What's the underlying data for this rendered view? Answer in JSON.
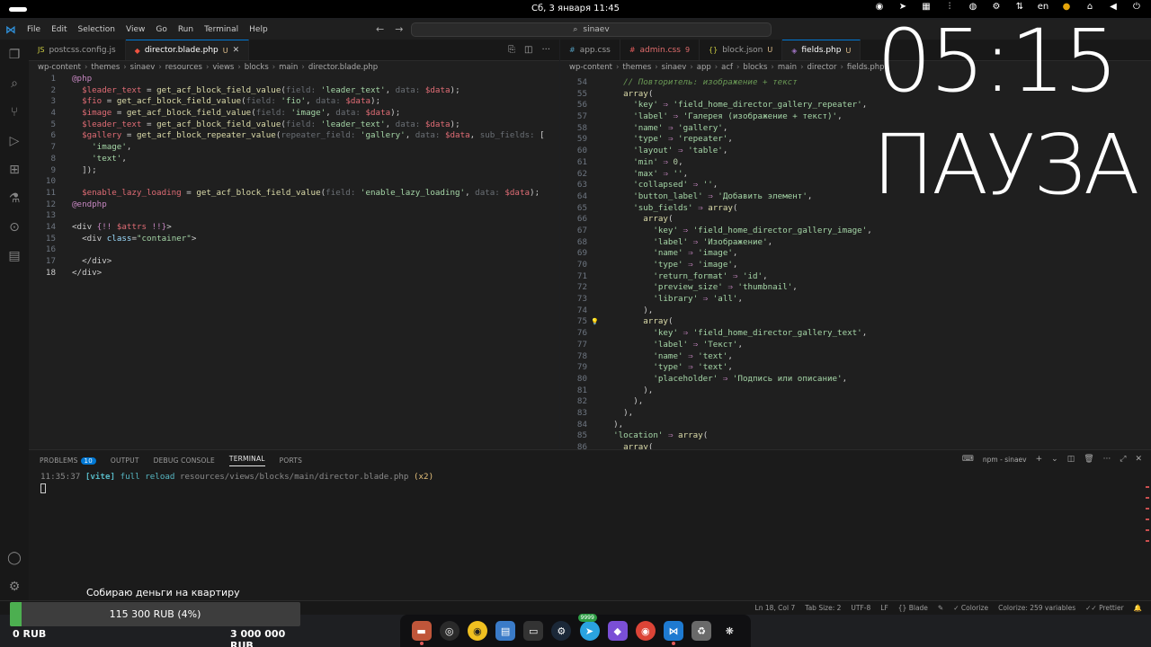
{
  "system": {
    "clock": "Сб, 3 января  11:45",
    "language": "en"
  },
  "menu": {
    "items": [
      "File",
      "Edit",
      "Selection",
      "View",
      "Go",
      "Run",
      "Terminal",
      "Help"
    ],
    "search": "sinaev"
  },
  "left_editor": {
    "tabs": [
      {
        "label": "postcss.config.js",
        "icon": "JS",
        "modified": "",
        "active": false
      },
      {
        "label": "director.blade.php",
        "icon": "blade-icon",
        "modified": "U",
        "active": true
      }
    ],
    "breadcrumb": [
      "wp-content",
      "themes",
      "sinaev",
      "resources",
      "views",
      "blocks",
      "main",
      "director.blade.php"
    ]
  },
  "right_editor": {
    "tabs": [
      {
        "label": "app.css",
        "icon": "#",
        "modified": "",
        "active": false
      },
      {
        "label": "admin.css",
        "icon": "#",
        "modified": "9",
        "active": false
      },
      {
        "label": "block.json",
        "icon": "{}",
        "modified": "U",
        "active": false
      },
      {
        "label": "fields.php",
        "icon": "php-icon",
        "modified": "U",
        "active": true
      }
    ],
    "breadcrumb": [
      "wp-content",
      "themes",
      "sinaev",
      "app",
      "acf",
      "blocks",
      "main",
      "director",
      "fields.php"
    ]
  },
  "panel": {
    "tabs": [
      "PROBLEMS",
      "OUTPUT",
      "DEBUG CONSOLE",
      "TERMINAL",
      "PORTS"
    ],
    "problems_count": "10",
    "terminal_name": "npm - sinaev",
    "terminal_line": {
      "time": "11:35:37",
      "tag": "[vite]",
      "message": "full reload",
      "path": "resources/views/blocks/main/director.blade.php",
      "count": "(x2)"
    }
  },
  "statusbar": {
    "position": "Ln 18, Col 7",
    "tab_size": "Tab Size: 2",
    "encoding": "UTF-8",
    "eol": "LF",
    "language": "Blade",
    "colorize": "Colorize",
    "colorize_vars": "Colorize: 259 variables",
    "prettier": "Prettier"
  },
  "overlay": {
    "timer": "05:15",
    "status": "ПАУЗА",
    "fundraiser": {
      "title": "Собираю деньги на квартиру",
      "current_label": "115 300 RUB (4%)",
      "progress_fraction": 0.04,
      "min_label": "0 RUB",
      "max_label": "3 000 000 RUB"
    }
  },
  "dock": {
    "items": [
      "files-icon",
      "obs-icon",
      "rhythmbox-icon",
      "text-editor-icon",
      "terminal-icon",
      "steam-icon",
      "telegram-icon",
      "obsidian-icon",
      "chrome-icon",
      "vscode-icon",
      "trash-icon",
      "settings-icon"
    ],
    "telegram_badge": "9999"
  },
  "code_left": [
    {
      "n": "1",
      "html": "<span class='t-kw'>@php</span>"
    },
    {
      "n": "2",
      "html": "  <span class='t-var'>$leader_text</span> = <span class='t-fn'>get_acf_block_field_value</span>(<span class='t-hint'>field: </span><span class='t-str'>'leader_text'</span>, <span class='t-hint'>data: </span><span class='t-var'>$data</span>);"
    },
    {
      "n": "3",
      "html": "  <span class='t-var'>$fio</span> = <span class='t-fn'>get_acf_block_field_value</span>(<span class='t-hint'>field: </span><span class='t-str'>'fio'</span>, <span class='t-hint'>data: </span><span class='t-var'>$data</span>);"
    },
    {
      "n": "4",
      "html": "  <span class='t-var'>$image</span> = <span class='t-fn'>get_acf_block_field_value</span>(<span class='t-hint'>field: </span><span class='t-str'>'image'</span>, <span class='t-hint'>data: </span><span class='t-var'>$data</span>);"
    },
    {
      "n": "5",
      "html": "  <span class='t-var'>$leader_text</span> = <span class='t-fn'>get_acf_block_field_value</span>(<span class='t-hint'>field: </span><span class='t-str'>'leader_text'</span>, <span class='t-hint'>data: </span><span class='t-var'>$data</span>);"
    },
    {
      "n": "6",
      "html": "  <span class='t-var'>$gallery</span> = <span class='t-fn'>get_acf_block_repeater_value</span>(<span class='t-hint'>repeater_field: </span><span class='t-str'>'gallery'</span>, <span class='t-hint'>data: </span><span class='t-var'>$data</span>, <span class='t-hint'>sub_fields: </span>["
    },
    {
      "n": "7",
      "html": "    <span class='t-str'>'image'</span>,"
    },
    {
      "n": "8",
      "html": "    <span class='t-str'>'text'</span>,"
    },
    {
      "n": "9",
      "html": "  ]);"
    },
    {
      "n": "10",
      "html": ""
    },
    {
      "n": "11",
      "html": "  <span class='t-var'>$enable_lazy_loading</span> = <span class='t-fn'>get_acf_block_field_value</span>(<span class='t-hint'>field: </span><span class='t-str'>'enable_lazy_loading'</span>, <span class='t-hint'>data: </span><span class='t-var'>$data</span>);"
    },
    {
      "n": "12",
      "html": "<span class='t-kw'>@endphp</span>"
    },
    {
      "n": "13",
      "html": ""
    },
    {
      "n": "14",
      "html": "<span class='t-tag'>&lt;div</span> <span class='t-kw'>{!!</span> <span class='t-var'>$attrs</span> <span class='t-kw'>!!}</span><span class='t-tag'>&gt;</span>"
    },
    {
      "n": "15",
      "html": "  <span class='t-tag'>&lt;div</span> <span class='t-attr'>class</span>=<span class='t-str'>\"container\"</span><span class='t-tag'>&gt;</span>"
    },
    {
      "n": "16",
      "html": ""
    },
    {
      "n": "17",
      "html": "  <span class='t-tag'>&lt;/div&gt;</span>"
    },
    {
      "n": "18",
      "html": "<span class='t-tag'>&lt;/div&gt;</span>",
      "current": true
    }
  ],
  "code_right": [
    {
      "n": "54",
      "html": "    <span class='t-com'>// Повторитель: изображение + текст</span>"
    },
    {
      "n": "55",
      "html": "    <span class='t-fn'>array</span>("
    },
    {
      "n": "56",
      "html": "      <span class='t-str'>'key'</span> <span class='t-kw'>⇒</span> <span class='t-str'>'field_home_director_gallery_repeater'</span>,"
    },
    {
      "n": "57",
      "html": "      <span class='t-str'>'label'</span> <span class='t-kw'>⇒</span> <span class='t-str'>'Галерея (изображение + текст)'</span>,"
    },
    {
      "n": "58",
      "html": "      <span class='t-str'>'name'</span> <span class='t-kw'>⇒</span> <span class='t-str'>'gallery'</span>,"
    },
    {
      "n": "59",
      "html": "      <span class='t-str'>'type'</span> <span class='t-kw'>⇒</span> <span class='t-str'>'repeater'</span>,"
    },
    {
      "n": "60",
      "html": "      <span class='t-str'>'layout'</span> <span class='t-kw'>⇒</span> <span class='t-str'>'table'</span>,"
    },
    {
      "n": "61",
      "html": "      <span class='t-str'>'min'</span> <span class='t-kw'>⇒</span> <span class='t-num'>0</span>,"
    },
    {
      "n": "62",
      "html": "      <span class='t-str'>'max'</span> <span class='t-kw'>⇒</span> <span class='t-str'>''</span>,"
    },
    {
      "n": "63",
      "html": "      <span class='t-str'>'collapsed'</span> <span class='t-kw'>⇒</span> <span class='t-str'>''</span>,"
    },
    {
      "n": "64",
      "html": "      <span class='t-str'>'button_label'</span> <span class='t-kw'>⇒</span> <span class='t-str'>'Добавить элемент'</span>,"
    },
    {
      "n": "65",
      "html": "      <span class='t-str'>'sub_fields'</span> <span class='t-kw'>⇒</span> <span class='t-fn'>array</span>("
    },
    {
      "n": "66",
      "html": "        <span class='t-fn'>array</span>("
    },
    {
      "n": "67",
      "html": "          <span class='t-str'>'key'</span> <span class='t-kw'>⇒</span> <span class='t-str'>'field_home_director_gallery_image'</span>,"
    },
    {
      "n": "68",
      "html": "          <span class='t-str'>'label'</span> <span class='t-kw'>⇒</span> <span class='t-str'>'Изображение'</span>,"
    },
    {
      "n": "69",
      "html": "          <span class='t-str'>'name'</span> <span class='t-kw'>⇒</span> <span class='t-str'>'image'</span>,"
    },
    {
      "n": "70",
      "html": "          <span class='t-str'>'type'</span> <span class='t-kw'>⇒</span> <span class='t-str'>'image'</span>,"
    },
    {
      "n": "71",
      "html": "          <span class='t-str'>'return_format'</span> <span class='t-kw'>⇒</span> <span class='t-str'>'id'</span>,"
    },
    {
      "n": "72",
      "html": "          <span class='t-str'>'preview_size'</span> <span class='t-kw'>⇒</span> <span class='t-str'>'thumbnail'</span>,"
    },
    {
      "n": "73",
      "html": "          <span class='t-str'>'library'</span> <span class='t-kw'>⇒</span> <span class='t-str'>'all'</span>,"
    },
    {
      "n": "74",
      "html": "        ),"
    },
    {
      "n": "75",
      "html": "        <span class='t-fn'>array</span>(",
      "bulb": true
    },
    {
      "n": "76",
      "html": "          <span class='t-str'>'key'</span> <span class='t-kw'>⇒</span> <span class='t-str'>'field_home_director_gallery_text'</span>,"
    },
    {
      "n": "77",
      "html": "          <span class='t-str'>'label'</span> <span class='t-kw'>⇒</span> <span class='t-str'>'Текст'</span>,"
    },
    {
      "n": "78",
      "html": "          <span class='t-str'>'name'</span> <span class='t-kw'>⇒</span> <span class='t-str'>'text'</span>,"
    },
    {
      "n": "79",
      "html": "          <span class='t-str'>'type'</span> <span class='t-kw'>⇒</span> <span class='t-str'>'text'</span>,"
    },
    {
      "n": "80",
      "html": "          <span class='t-str'>'placeholder'</span> <span class='t-kw'>⇒</span> <span class='t-str'>'Подпись или описание'</span>,"
    },
    {
      "n": "81",
      "html": "        ),"
    },
    {
      "n": "82",
      "html": "      ),"
    },
    {
      "n": "83",
      "html": "    ),"
    },
    {
      "n": "84",
      "html": "  ),"
    },
    {
      "n": "85",
      "html": "  <span class='t-str'>'location'</span> <span class='t-kw'>⇒</span> <span class='t-fn'>array</span>("
    },
    {
      "n": "86",
      "html": "    <span class='t-fn'>array</span>("
    }
  ]
}
